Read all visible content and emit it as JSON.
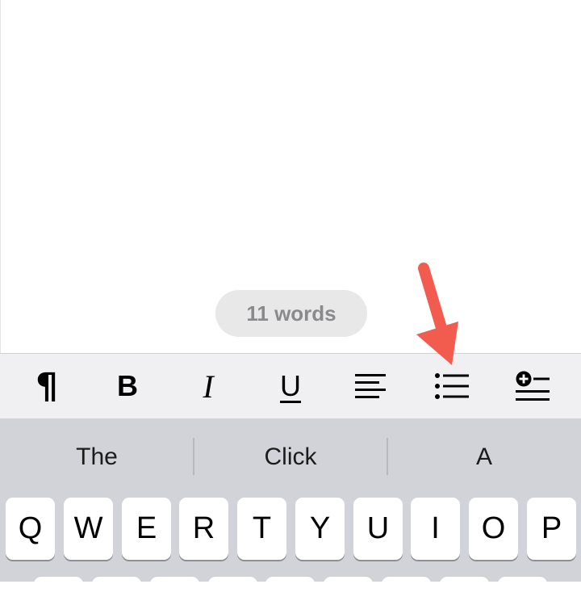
{
  "document": {
    "word_count": "11 words"
  },
  "toolbar": {
    "buttons": [
      {
        "name": "paragraph-style",
        "glyph": "¶"
      },
      {
        "name": "bold",
        "glyph": "B"
      },
      {
        "name": "italic",
        "glyph": "I"
      },
      {
        "name": "underline",
        "glyph": "U"
      },
      {
        "name": "align-left",
        "icon": "align-left-icon"
      },
      {
        "name": "bulleted-list",
        "icon": "bulleted-list-icon"
      },
      {
        "name": "insert",
        "icon": "insert-plus-icon"
      }
    ]
  },
  "keyboard": {
    "suggestions": [
      "The",
      "Click",
      "A"
    ],
    "top_row": [
      "Q",
      "W",
      "E",
      "R",
      "T",
      "Y",
      "U",
      "I",
      "O",
      "P"
    ]
  },
  "annotation": {
    "arrow_color": "#f25c4f"
  }
}
